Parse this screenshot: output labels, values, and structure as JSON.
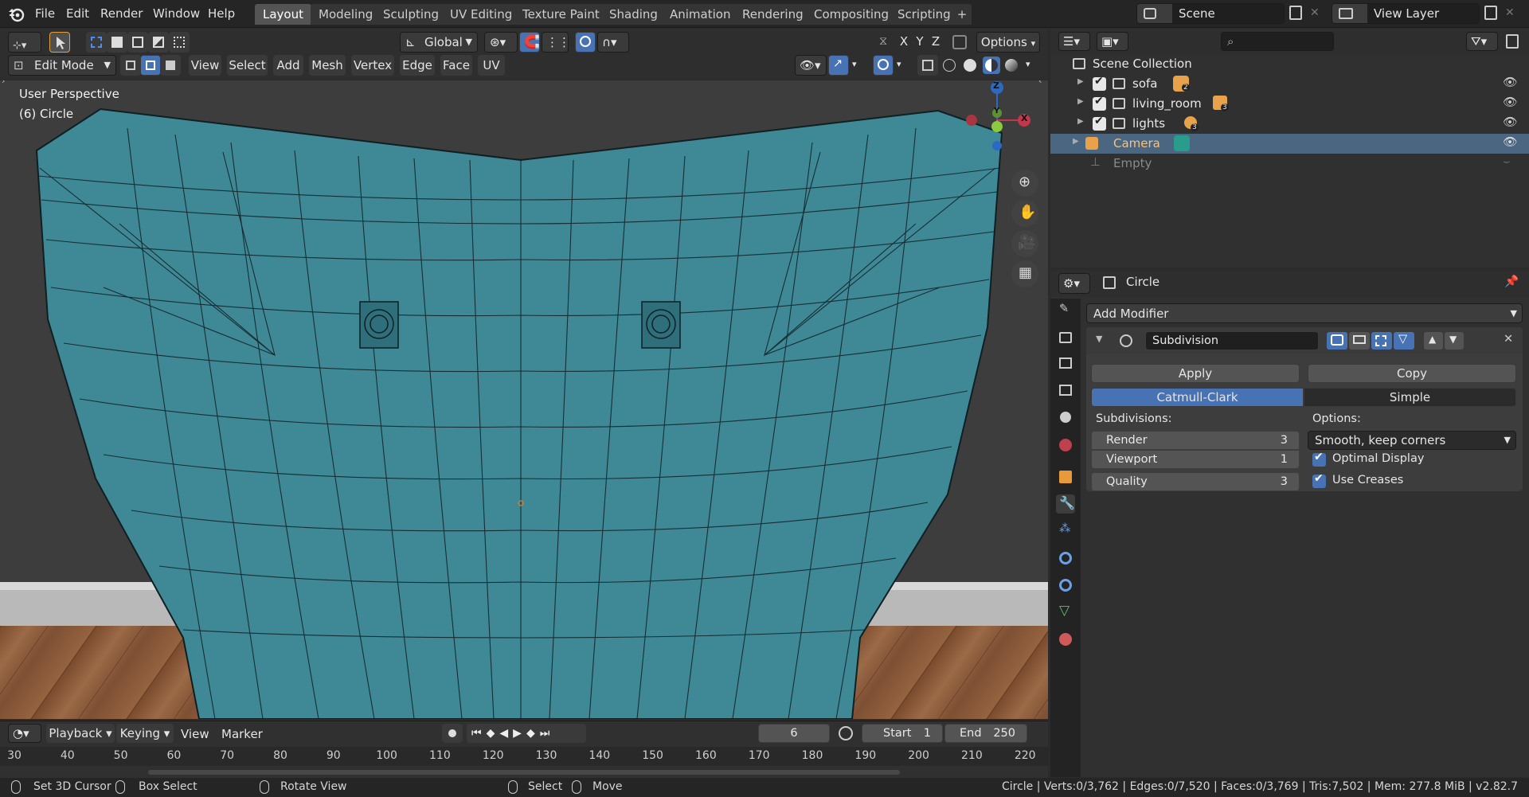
{
  "menubar": {
    "items": [
      "File",
      "Edit",
      "Render",
      "Window",
      "Help"
    ],
    "workspaces": [
      "Layout",
      "Modeling",
      "Sculpting",
      "UV Editing",
      "Texture Paint",
      "Shading",
      "Animation",
      "Rendering",
      "Compositing",
      "Scripting"
    ],
    "add_tab": "+",
    "scene_label": "Scene",
    "view_layer_label": "View Layer"
  },
  "viewport_header": {
    "orientation": "Global",
    "options_label": "Options",
    "axes": [
      "X",
      "Y",
      "Z"
    ],
    "mode": "Edit Mode",
    "menus": [
      "View",
      "Select",
      "Add",
      "Mesh",
      "Vertex",
      "Edge",
      "Face",
      "UV"
    ]
  },
  "viewport": {
    "perspective_label": "User Perspective",
    "object_label": "(6) Circle",
    "gizmo_axes": {
      "z": "Z",
      "y": "Y",
      "x": "X"
    }
  },
  "timeline": {
    "menus": [
      "Playback",
      "Keying",
      "View",
      "Marker"
    ],
    "current_frame": "6",
    "start_label": "Start",
    "start_value": "1",
    "end_label": "End",
    "end_value": "250",
    "ruler_ticks": [
      "30",
      "40",
      "50",
      "60",
      "70",
      "80",
      "90",
      "100",
      "110",
      "120",
      "130",
      "140",
      "150",
      "160",
      "170",
      "180",
      "190",
      "200",
      "210",
      "220"
    ]
  },
  "outliner": {
    "root": "Scene Collection",
    "items": [
      {
        "label": "sofa",
        "badge": "2"
      },
      {
        "label": "living_room",
        "badge": "3"
      },
      {
        "label": "lights",
        "badge": "3"
      },
      {
        "label": "Camera",
        "badge": ""
      },
      {
        "label": "Empty",
        "badge": ""
      }
    ]
  },
  "properties": {
    "object_name": "Circle",
    "add_modifier": "Add Modifier",
    "modifier_name": "Subdivision",
    "apply_label": "Apply",
    "copy_label": "Copy",
    "catmull_label": "Catmull-Clark",
    "simple_label": "Simple",
    "subdivisions_label": "Subdivisions:",
    "options_label": "Options:",
    "render_label": "Render",
    "render_value": "3",
    "viewport_label": "Viewport",
    "viewport_value": "1",
    "quality_label": "Quality",
    "quality_value": "3",
    "uv_smooth": "Smooth, keep corners",
    "optimal_display": "Optimal Display",
    "use_creases": "Use Creases"
  },
  "statusbar": {
    "set_cursor": "Set 3D Cursor",
    "box_select": "Box Select",
    "rotate_view": "Rotate View",
    "select": "Select",
    "move": "Move",
    "stats": "Circle | Verts:0/3,762 | Edges:0/7,520 | Faces:0/3,769 | Tris:7,502 | Mem: 277.8 MiB | v2.82.7"
  },
  "colors": {
    "accent_blue": "#4772b3",
    "mesh_teal": "#3f8896",
    "floor_wood": "#8a5a3a",
    "camera_orange": "#e8a24a"
  }
}
